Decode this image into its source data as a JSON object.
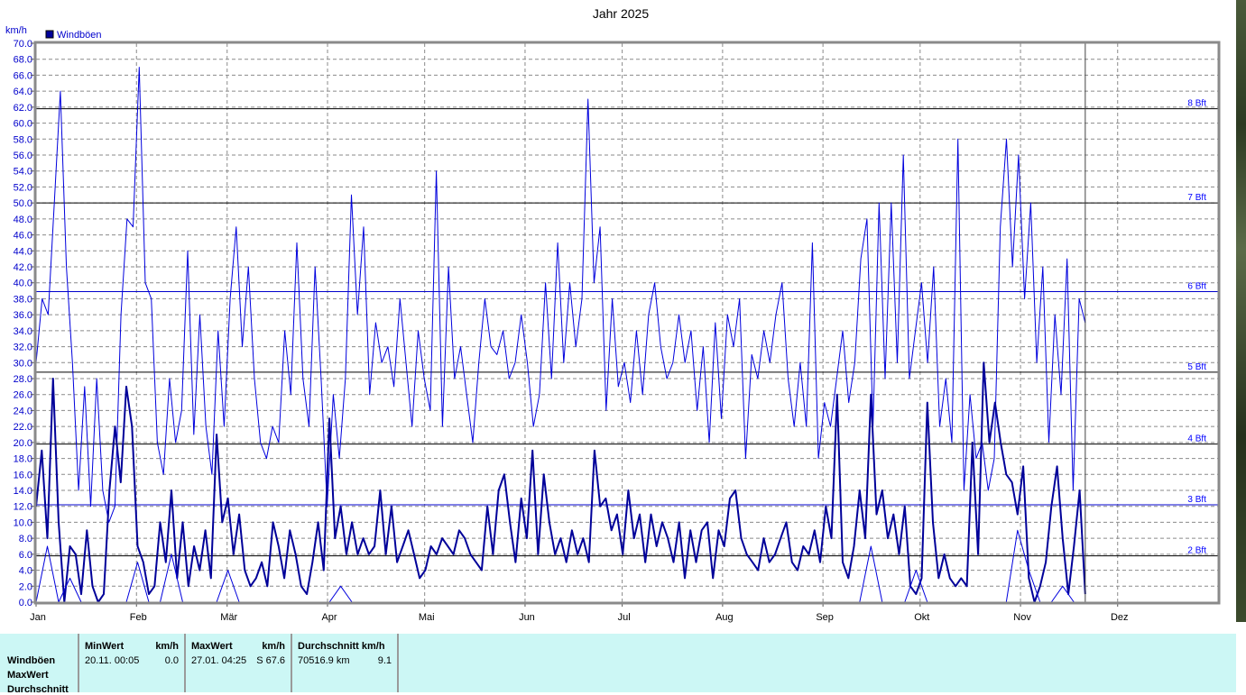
{
  "chart_data": {
    "type": "line",
    "title": "Jahr 2025",
    "ylabel": "km/h",
    "ylim": [
      0,
      70
    ],
    "ytick_step": 2,
    "xlim_days": [
      0,
      365
    ],
    "data_end_day": 324,
    "month_labels": [
      "Jan",
      "Feb",
      "Mär",
      "Apr",
      "Mai",
      "Jun",
      "Jul",
      "Aug",
      "Sep",
      "Okt",
      "Nov",
      "Dez"
    ],
    "month_start_days": [
      0,
      31,
      59,
      90,
      120,
      151,
      181,
      212,
      243,
      273,
      304,
      334
    ],
    "legend": [
      {
        "label": "Windböen",
        "color": "#000099"
      }
    ],
    "legend_position": "top-left",
    "grid": true,
    "beaufort_lines": [
      {
        "label": "2 Bft",
        "value": 5.8,
        "color": "#000000"
      },
      {
        "label": "3 Bft",
        "value": 12.2,
        "color": "#0000cc"
      },
      {
        "label": "4 Bft",
        "value": 19.8,
        "color": "#000000"
      },
      {
        "label": "5 Bft",
        "value": 28.8,
        "color": "#000000"
      },
      {
        "label": "6 Bft",
        "value": 38.9,
        "color": "#0000cc"
      },
      {
        "label": "7 Bft",
        "value": 50.0,
        "color": "#000000"
      },
      {
        "label": "8 Bft",
        "value": 61.8,
        "color": "#000000"
      }
    ],
    "series": [
      {
        "name": "Windböen max",
        "color": "#0000dd",
        "width": 1,
        "values": [
          30,
          38,
          36,
          50,
          64,
          42,
          30,
          14,
          27,
          12,
          28,
          14,
          10,
          12,
          36,
          48,
          47,
          67,
          40,
          38,
          20,
          16,
          28,
          20,
          24,
          44,
          21,
          36,
          22,
          16,
          34,
          22,
          38,
          47,
          32,
          42,
          28,
          20,
          18,
          22,
          20,
          34,
          26,
          45,
          28,
          22,
          42,
          28,
          12,
          26,
          18,
          28,
          51,
          36,
          47,
          26,
          35,
          30,
          32,
          27,
          38,
          30,
          22,
          34,
          28,
          24,
          54,
          22,
          42,
          28,
          32,
          26,
          20,
          30,
          38,
          32,
          31,
          34,
          28,
          30,
          36,
          30,
          22,
          26,
          40,
          28,
          45,
          30,
          40,
          32,
          38,
          63,
          40,
          47,
          24,
          38,
          27,
          30,
          25,
          34,
          26,
          36,
          40,
          32,
          28,
          30,
          36,
          30,
          34,
          24,
          32,
          20,
          35,
          23,
          36,
          32,
          38,
          18,
          31,
          28,
          34,
          30,
          36,
          40,
          28,
          22,
          30,
          22,
          45,
          18,
          25,
          22,
          28,
          34,
          25,
          30,
          43,
          48,
          22,
          50,
          28,
          50,
          30,
          56,
          28,
          34,
          40,
          30,
          42,
          22,
          28,
          20,
          58,
          14,
          26,
          18,
          20,
          14,
          18,
          47,
          58,
          42,
          56,
          38,
          50,
          30,
          42,
          20,
          36,
          26,
          43,
          14,
          38,
          35
        ]
      },
      {
        "name": "Windböen mittel",
        "color": "#000099",
        "width": 2,
        "values": [
          12,
          19,
          8,
          28,
          10,
          0,
          7,
          6,
          1,
          9,
          2,
          0,
          1,
          14,
          22,
          15,
          27,
          22,
          7,
          5,
          1,
          2,
          10,
          5,
          14,
          3,
          10,
          2,
          7,
          4,
          9,
          3,
          21,
          10,
          13,
          6,
          11,
          4,
          2,
          3,
          5,
          2,
          10,
          7,
          3,
          9,
          6,
          2,
          1,
          5,
          10,
          4,
          23,
          8,
          12,
          6,
          10,
          6,
          8,
          6,
          7,
          14,
          6,
          12,
          5,
          7,
          9,
          6,
          3,
          4,
          7,
          6,
          8,
          7,
          6,
          9,
          8,
          6,
          5,
          4,
          12,
          6,
          14,
          16,
          10,
          5,
          13,
          8,
          19,
          6,
          16,
          10,
          6,
          8,
          5,
          9,
          6,
          8,
          5,
          19,
          12,
          13,
          9,
          11,
          6,
          14,
          8,
          11,
          5,
          11,
          7,
          10,
          8,
          5,
          10,
          3,
          9,
          5,
          9,
          10,
          3,
          9,
          7,
          13,
          14,
          8,
          6,
          5,
          4,
          8,
          5,
          6,
          8,
          10,
          5,
          4,
          7,
          6,
          9,
          5,
          12,
          8,
          26,
          5,
          3,
          7,
          14,
          8,
          26,
          11,
          14,
          8,
          11,
          6,
          12,
          2,
          1,
          3,
          25,
          10,
          3,
          6,
          3,
          2,
          3,
          2,
          20,
          6,
          30,
          20,
          25,
          20,
          16,
          15,
          11,
          17,
          3,
          0,
          2,
          5,
          12,
          17,
          8,
          1,
          7,
          14,
          1
        ]
      },
      {
        "name": "Windböen min",
        "color": "#0000dd",
        "width": 1,
        "values": [
          0,
          7,
          0,
          3,
          0,
          0,
          0,
          0,
          0,
          5,
          0,
          0,
          6,
          0,
          0,
          0,
          0,
          4,
          0,
          0,
          0,
          0,
          0,
          0,
          0,
          0,
          0,
          2,
          0,
          0,
          0,
          0,
          0,
          0,
          0,
          0,
          0,
          0,
          0,
          0,
          0,
          0,
          0,
          0,
          0,
          0,
          0,
          0,
          0,
          0,
          0,
          0,
          0,
          0,
          0,
          0,
          0,
          0,
          0,
          0,
          0,
          0,
          0,
          0,
          0,
          0,
          0,
          0,
          0,
          0,
          0,
          0,
          0,
          0,
          7,
          0,
          0,
          0,
          4,
          0,
          0,
          0,
          0,
          0,
          0,
          0,
          0,
          9,
          4,
          0,
          0,
          2,
          0,
          0
        ]
      }
    ]
  },
  "stats": {
    "row_labels": [
      "Windböen",
      "MaxWert",
      "Durchschnitt"
    ],
    "min": {
      "header": "MinWert",
      "unit": "km/h",
      "time": "20.11.  00:05",
      "value": "0.0"
    },
    "max": {
      "header": "MaxWert",
      "unit": "km/h",
      "time": "27.01.  04:25",
      "value": "S 67.6"
    },
    "avg": {
      "header": "Durchschnitt km/h",
      "distance": "70516.9 km",
      "value": "9.1"
    }
  }
}
